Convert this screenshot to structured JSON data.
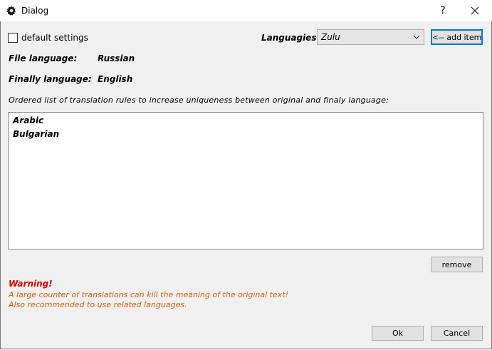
{
  "window": {
    "title": "Dialog",
    "help_label": "?",
    "close_label": "✕"
  },
  "settings": {
    "default_settings_label": "default settings",
    "default_settings_checked": false
  },
  "languages": {
    "label": "Languagies",
    "selected": "Zulu",
    "add_item_label": "<-- add item"
  },
  "file_language": {
    "label": "File language:",
    "value": "Russian"
  },
  "final_language": {
    "label": "Finally language:",
    "value": "English"
  },
  "rules": {
    "description": "Ordered list of translation rules to increase uniqueness between original and finaly language:",
    "items": [
      "Arabic",
      "Bulgarian"
    ],
    "remove_label": "remove"
  },
  "warning": {
    "title": "Warning!",
    "line1": "A large counter of translations can kill the meaning of the original text!",
    "line2": "Also recommended to use related languages."
  },
  "footer": {
    "ok_label": "Ok",
    "cancel_label": "Cancel"
  },
  "colors": {
    "warning_title": "#e00000",
    "warning_text": "#e05a00",
    "focus_border": "#0078d7"
  }
}
